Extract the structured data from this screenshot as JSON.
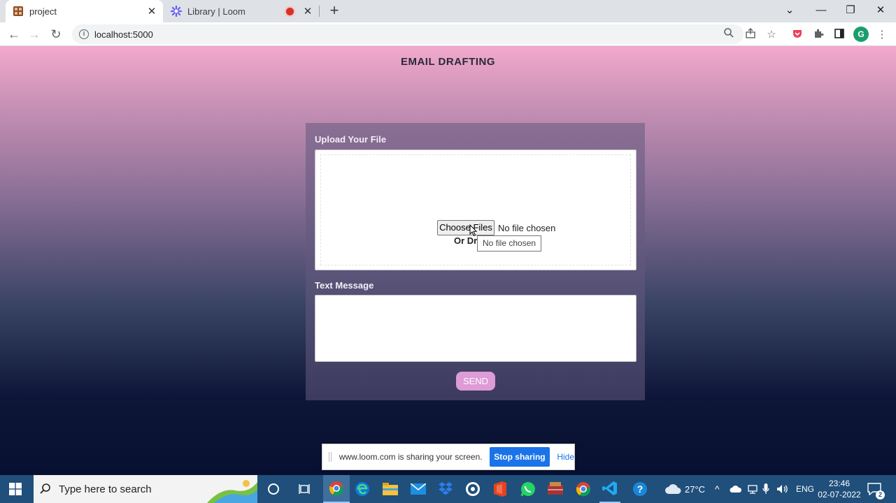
{
  "browser": {
    "tabs": [
      {
        "title": "project",
        "active": true
      },
      {
        "title": "Library | Loom",
        "active": false
      }
    ],
    "address": "localhost:5000"
  },
  "page": {
    "title": "EMAIL DRAFTING",
    "upload_label": "Upload Your File",
    "choose_files_label": "Choose Files",
    "no_file_text": "No file chosen",
    "or_drag_text": "Or Dr",
    "tooltip_text": "No file chosen",
    "message_label": "Text Message",
    "message_value": "",
    "send_label": "SEND"
  },
  "share_notice": {
    "text": "www.loom.com is sharing your screen.",
    "stop_label": "Stop sharing",
    "hide_label": "Hide"
  },
  "taskbar": {
    "search_placeholder": "Type here to search",
    "weather": "27°C",
    "language": "ENG",
    "time": "23:46",
    "date": "02-07-2022",
    "notifications": "2"
  },
  "colors": {
    "send_button": "#dd9bd7",
    "stop_button": "#1a73e8",
    "taskbar": "#1f4f7a"
  }
}
